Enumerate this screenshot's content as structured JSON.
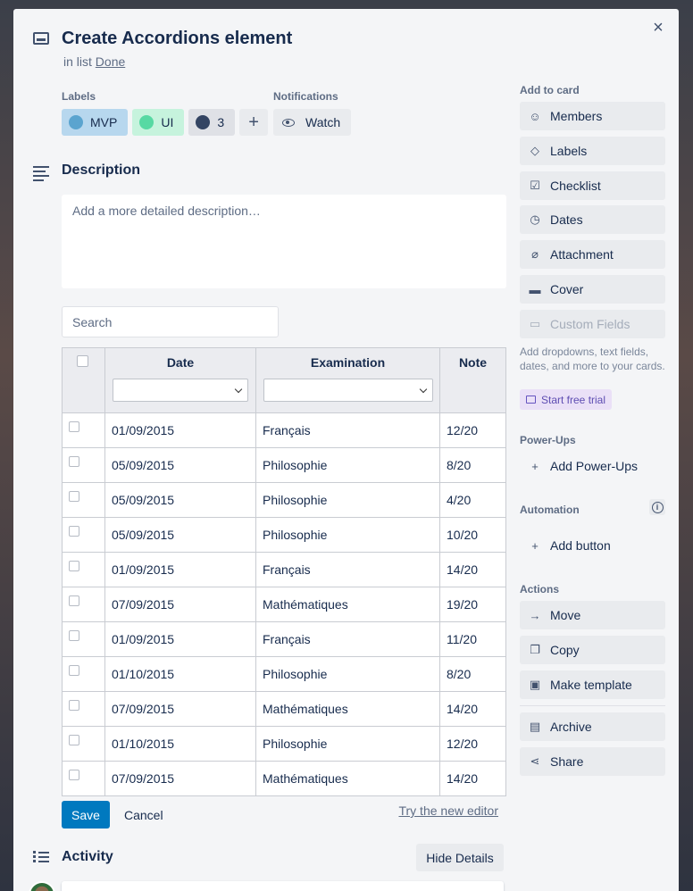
{
  "card": {
    "title": "Create Accordions element",
    "in_list_prefix": "in list",
    "list_name": "Done",
    "close_icon": "×"
  },
  "labels": {
    "heading": "Labels",
    "items": [
      {
        "text": "MVP",
        "bg": "#b7d7ee",
        "dot": "#5ba4cf"
      },
      {
        "text": "UI",
        "bg": "#c6f3dd",
        "dot": "#57d9a3"
      },
      {
        "text": "3",
        "bg": "#dfe1e6",
        "dot": "#344563"
      }
    ],
    "add": "+"
  },
  "notifications": {
    "heading": "Notifications",
    "watch": "Watch"
  },
  "description": {
    "title": "Description",
    "placeholder": "Add a more detailed description…"
  },
  "table": {
    "search_placeholder": "Search",
    "columns": [
      "Date",
      "Examination",
      "Note"
    ],
    "rows": [
      [
        "01/09/2015",
        "Français",
        "12/20"
      ],
      [
        "05/09/2015",
        "Philosophie",
        "8/20"
      ],
      [
        "05/09/2015",
        "Philosophie",
        "4/20"
      ],
      [
        "05/09/2015",
        "Philosophie",
        "10/20"
      ],
      [
        "01/09/2015",
        "Français",
        "14/20"
      ],
      [
        "07/09/2015",
        "Mathématiques",
        "19/20"
      ],
      [
        "01/09/2015",
        "Français",
        "11/20"
      ],
      [
        "01/10/2015",
        "Philosophie",
        "8/20"
      ],
      [
        "07/09/2015",
        "Mathématiques",
        "14/20"
      ],
      [
        "01/10/2015",
        "Philosophie",
        "12/20"
      ],
      [
        "07/09/2015",
        "Mathématiques",
        "14/20"
      ]
    ]
  },
  "editor": {
    "save": "Save",
    "cancel": "Cancel",
    "try_new": "Try the new editor"
  },
  "activity": {
    "title": "Activity",
    "hide_details": "Hide Details"
  },
  "sidebar": {
    "add_to_card": "Add to card",
    "members": "Members",
    "labels": "Labels",
    "checklist": "Checklist",
    "dates": "Dates",
    "attachment": "Attachment",
    "cover": "Cover",
    "custom_fields": "Custom Fields",
    "custom_fields_hint": "Add dropdowns, text fields, dates, and more to your cards.",
    "start_trial": "Start free trial",
    "power_ups": "Power-Ups",
    "add_power_ups": "Add Power-Ups",
    "automation": "Automation",
    "add_button": "Add button",
    "actions": "Actions",
    "move": "Move",
    "copy": "Copy",
    "make_template": "Make template",
    "archive": "Archive",
    "share": "Share"
  }
}
